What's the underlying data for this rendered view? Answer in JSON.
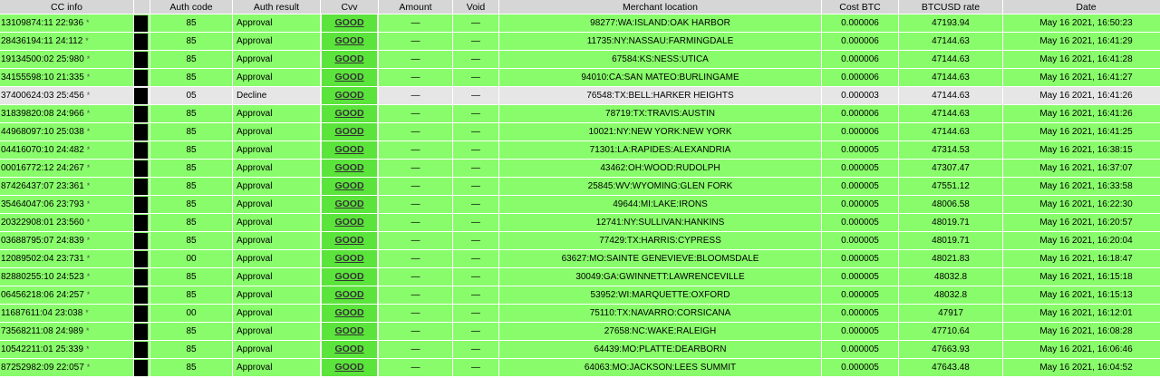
{
  "headers": {
    "cc": "CC info",
    "blank": "",
    "auth_code": "Auth code",
    "auth_result": "Auth result",
    "cvv": "Cvv",
    "amount": "Amount",
    "void": "Void",
    "merchant": "Merchant location",
    "cost": "Cost BTC",
    "rate": "BTCUSD rate",
    "date": "Date"
  },
  "star": "*",
  "rows": [
    {
      "cc": "13109874:11 22:936",
      "code": "85",
      "result": "Approval",
      "cvv": "GOOD",
      "amount": "—",
      "void": "—",
      "merchant": "98277:WA:ISLAND:OAK HARBOR",
      "cost": "0.000006",
      "rate": "47193.94",
      "date": "May 16 2021, 16:50:23"
    },
    {
      "cc": "28436194:11 24:112",
      "code": "85",
      "result": "Approval",
      "cvv": "GOOD",
      "amount": "—",
      "void": "—",
      "merchant": "11735:NY:NASSAU:FARMINGDALE",
      "cost": "0.000006",
      "rate": "47144.63",
      "date": "May 16 2021, 16:41:29"
    },
    {
      "cc": "19134500:02 25:980",
      "code": "85",
      "result": "Approval",
      "cvv": "GOOD",
      "amount": "—",
      "void": "—",
      "merchant": "67584:KS:NESS:UTICA",
      "cost": "0.000006",
      "rate": "47144.63",
      "date": "May 16 2021, 16:41:28"
    },
    {
      "cc": "34155598:10 21:335",
      "code": "85",
      "result": "Approval",
      "cvv": "GOOD",
      "amount": "—",
      "void": "—",
      "merchant": "94010:CA:SAN MATEO:BURLINGAME",
      "cost": "0.000006",
      "rate": "47144.63",
      "date": "May 16 2021, 16:41:27"
    },
    {
      "cc": "37400624:03 25:456",
      "code": "05",
      "result": "Decline",
      "cvv": "GOOD",
      "amount": "—",
      "void": "—",
      "merchant": "76548:TX:BELL:HARKER HEIGHTS",
      "cost": "0.000003",
      "rate": "47144.63",
      "date": "May 16 2021, 16:41:26",
      "decline": true
    },
    {
      "cc": "31839820:08 24:966",
      "code": "85",
      "result": "Approval",
      "cvv": "GOOD",
      "amount": "—",
      "void": "—",
      "merchant": "78719:TX:TRAVIS:AUSTIN",
      "cost": "0.000006",
      "rate": "47144.63",
      "date": "May 16 2021, 16:41:26"
    },
    {
      "cc": "44968097:10 25:038",
      "code": "85",
      "result": "Approval",
      "cvv": "GOOD",
      "amount": "—",
      "void": "—",
      "merchant": "10021:NY:NEW YORK:NEW YORK",
      "cost": "0.000006",
      "rate": "47144.63",
      "date": "May 16 2021, 16:41:25"
    },
    {
      "cc": "04416070:10 24:482",
      "code": "85",
      "result": "Approval",
      "cvv": "GOOD",
      "amount": "—",
      "void": "—",
      "merchant": "71301:LA:RAPIDES:ALEXANDRIA",
      "cost": "0.000005",
      "rate": "47314.53",
      "date": "May 16 2021, 16:38:15"
    },
    {
      "cc": "00016772:12 24:267",
      "code": "85",
      "result": "Approval",
      "cvv": "GOOD",
      "amount": "—",
      "void": "—",
      "merchant": "43462:OH:WOOD:RUDOLPH",
      "cost": "0.000005",
      "rate": "47307.47",
      "date": "May 16 2021, 16:37:07"
    },
    {
      "cc": "87426437:07 23:361",
      "code": "85",
      "result": "Approval",
      "cvv": "GOOD",
      "amount": "—",
      "void": "—",
      "merchant": "25845:WV:WYOMING:GLEN FORK",
      "cost": "0.000005",
      "rate": "47551.12",
      "date": "May 16 2021, 16:33:58"
    },
    {
      "cc": "35464047:06 23:793",
      "code": "85",
      "result": "Approval",
      "cvv": "GOOD",
      "amount": "—",
      "void": "—",
      "merchant": "49644:MI:LAKE:IRONS",
      "cost": "0.000005",
      "rate": "48006.58",
      "date": "May 16 2021, 16:22:30"
    },
    {
      "cc": "20322908:01 23:560",
      "code": "85",
      "result": "Approval",
      "cvv": "GOOD",
      "amount": "—",
      "void": "—",
      "merchant": "12741:NY:SULLIVAN:HANKINS",
      "cost": "0.000005",
      "rate": "48019.71",
      "date": "May 16 2021, 16:20:57"
    },
    {
      "cc": "03688795:07 24:839",
      "code": "85",
      "result": "Approval",
      "cvv": "GOOD",
      "amount": "—",
      "void": "—",
      "merchant": "77429:TX:HARRIS:CYPRESS",
      "cost": "0.000005",
      "rate": "48019.71",
      "date": "May 16 2021, 16:20:04"
    },
    {
      "cc": "12089502:04 23:731",
      "code": "00",
      "result": "Approval",
      "cvv": "GOOD",
      "amount": "—",
      "void": "—",
      "merchant": "63627:MO:SAINTE GENEVIEVE:BLOOMSDALE",
      "cost": "0.000005",
      "rate": "48021.83",
      "date": "May 16 2021, 16:18:47"
    },
    {
      "cc": "82880255:10 24:523",
      "code": "85",
      "result": "Approval",
      "cvv": "GOOD",
      "amount": "—",
      "void": "—",
      "merchant": "30049:GA:GWINNETT:LAWRENCEVILLE",
      "cost": "0.000005",
      "rate": "48032.8",
      "date": "May 16 2021, 16:15:18"
    },
    {
      "cc": "06456218:06 24:257",
      "code": "85",
      "result": "Approval",
      "cvv": "GOOD",
      "amount": "—",
      "void": "—",
      "merchant": "53952:WI:MARQUETTE:OXFORD",
      "cost": "0.000005",
      "rate": "48032.8",
      "date": "May 16 2021, 16:15:13"
    },
    {
      "cc": "11687611:04 23:038",
      "code": "00",
      "result": "Approval",
      "cvv": "GOOD",
      "amount": "—",
      "void": "—",
      "merchant": "75110:TX:NAVARRO:CORSICANA",
      "cost": "0.000005",
      "rate": "47917",
      "date": "May 16 2021, 16:12:01"
    },
    {
      "cc": "73568211:08 24:989",
      "code": "85",
      "result": "Approval",
      "cvv": "GOOD",
      "amount": "—",
      "void": "—",
      "merchant": "27658:NC:WAKE:RALEIGH",
      "cost": "0.000005",
      "rate": "47710.64",
      "date": "May 16 2021, 16:08:28"
    },
    {
      "cc": "10542211:01 25:339",
      "code": "85",
      "result": "Approval",
      "cvv": "GOOD",
      "amount": "—",
      "void": "—",
      "merchant": "64439:MO:PLATTE:DEARBORN",
      "cost": "0.000005",
      "rate": "47663.93",
      "date": "May 16 2021, 16:06:46"
    },
    {
      "cc": "87252982:09 22:057",
      "code": "85",
      "result": "Approval",
      "cvv": "GOOD",
      "amount": "—",
      "void": "—",
      "merchant": "64063:MO:JACKSON:LEES SUMMIT",
      "cost": "0.000005",
      "rate": "47643.48",
      "date": "May 16 2021, 16:04:52"
    }
  ],
  "colors": {
    "approval_row": "#88fc6a",
    "decline_row": "#e6e6e6",
    "cvv_badge": "#5be43b",
    "header": "#d6d6d6"
  }
}
